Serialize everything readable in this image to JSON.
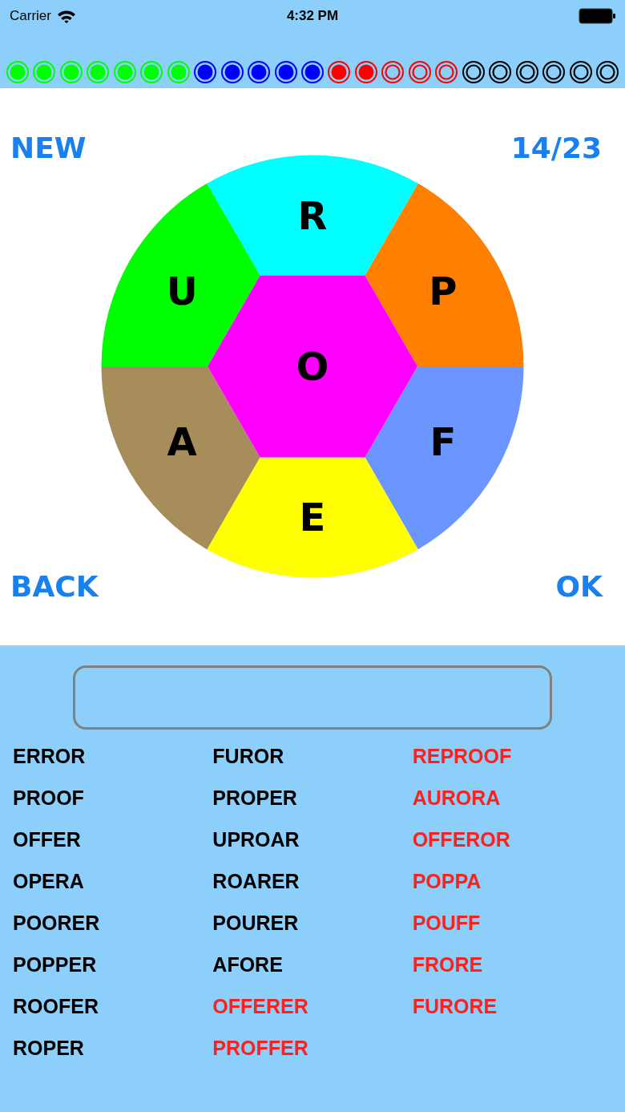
{
  "status_bar": {
    "carrier": "Carrier",
    "time": "4:32 PM"
  },
  "progress_dots": [
    {
      "color": "#00ff00",
      "filled": true
    },
    {
      "color": "#00ff00",
      "filled": true
    },
    {
      "color": "#00ff00",
      "filled": true
    },
    {
      "color": "#00ff00",
      "filled": true
    },
    {
      "color": "#00ff00",
      "filled": true
    },
    {
      "color": "#00ff00",
      "filled": true
    },
    {
      "color": "#00ff00",
      "filled": true
    },
    {
      "color": "#0000ff",
      "filled": true
    },
    {
      "color": "#0000ff",
      "filled": true
    },
    {
      "color": "#0000ff",
      "filled": true
    },
    {
      "color": "#0000ff",
      "filled": true
    },
    {
      "color": "#0000ff",
      "filled": true
    },
    {
      "color": "#ff0000",
      "filled": true
    },
    {
      "color": "#ff0000",
      "filled": true
    },
    {
      "color": "#ff0000",
      "filled": false
    },
    {
      "color": "#ff0000",
      "filled": false
    },
    {
      "color": "#ff0000",
      "filled": false
    },
    {
      "color": "#000000",
      "filled": false
    },
    {
      "color": "#000000",
      "filled": false
    },
    {
      "color": "#000000",
      "filled": false
    },
    {
      "color": "#000000",
      "filled": false
    },
    {
      "color": "#000000",
      "filled": false
    },
    {
      "color": "#000000",
      "filled": false
    }
  ],
  "top_controls": {
    "new_button": "NEW",
    "score": "14/23"
  },
  "wheel": {
    "center": {
      "letter": "O",
      "color": "#ff00ff"
    },
    "segments": [
      {
        "letter": "R",
        "color": "#00ffff"
      },
      {
        "letter": "P",
        "color": "#ff8000"
      },
      {
        "letter": "F",
        "color": "#6b96ff"
      },
      {
        "letter": "E",
        "color": "#ffff00"
      },
      {
        "letter": "A",
        "color": "#a68d5a"
      },
      {
        "letter": "U",
        "color": "#00ff00"
      }
    ]
  },
  "bottom_controls": {
    "back_button": "BACK",
    "ok_button": "OK"
  },
  "word_columns": [
    {
      "words": [
        {
          "text": "ERROR",
          "color": "#000000"
        },
        {
          "text": "PROOF",
          "color": "#000000"
        },
        {
          "text": "OFFER",
          "color": "#000000"
        },
        {
          "text": "OPERA",
          "color": "#000000"
        },
        {
          "text": "POORER",
          "color": "#000000"
        },
        {
          "text": "POPPER",
          "color": "#000000"
        },
        {
          "text": "ROOFER",
          "color": "#000000"
        },
        {
          "text": "ROPER",
          "color": "#000000"
        }
      ]
    },
    {
      "words": [
        {
          "text": "FUROR",
          "color": "#000000"
        },
        {
          "text": "PROPER",
          "color": "#000000"
        },
        {
          "text": "UPROAR",
          "color": "#000000"
        },
        {
          "text": "ROARER",
          "color": "#000000"
        },
        {
          "text": "POURER",
          "color": "#000000"
        },
        {
          "text": "AFORE",
          "color": "#000000"
        },
        {
          "text": "OFFERER",
          "color": "#ff1f1f"
        },
        {
          "text": "PROFFER",
          "color": "#ff1f1f"
        }
      ]
    },
    {
      "words": [
        {
          "text": "REPROOF",
          "color": "#ff1f1f"
        },
        {
          "text": "AURORA",
          "color": "#ff1f1f"
        },
        {
          "text": "OFFEROR",
          "color": "#ff1f1f"
        },
        {
          "text": "POPPA",
          "color": "#ff1f1f"
        },
        {
          "text": "POUFF",
          "color": "#ff1f1f"
        },
        {
          "text": "FRORE",
          "color": "#ff1f1f"
        },
        {
          "text": "FURORE",
          "color": "#ff1f1f"
        }
      ]
    }
  ]
}
